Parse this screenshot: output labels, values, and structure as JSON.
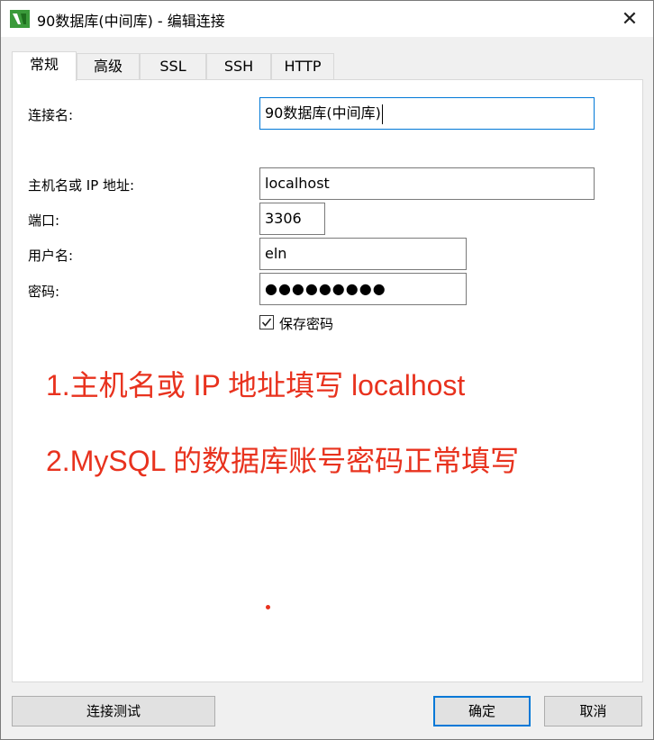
{
  "window": {
    "title": "90数据库(中间库) - 编辑连接",
    "close_symbol": "✕"
  },
  "tabs": [
    {
      "label": "常规",
      "active": true
    },
    {
      "label": "高级",
      "active": false
    },
    {
      "label": "SSL",
      "active": false
    },
    {
      "label": "SSH",
      "active": false
    },
    {
      "label": "HTTP",
      "active": false
    }
  ],
  "form": {
    "connection_name": {
      "label": "连接名:",
      "value": "90数据库(中间库)"
    },
    "host": {
      "label": "主机名或 IP 地址:",
      "value": "localhost"
    },
    "port": {
      "label": "端口:",
      "value": "3306"
    },
    "username": {
      "label": "用户名:",
      "value": "eln"
    },
    "password": {
      "label": "密码:",
      "value": "●●●●●●●●●"
    },
    "save_password": {
      "label": "保存密码",
      "checked": true
    }
  },
  "annotations": {
    "line1": "1.主机名或 IP 地址填写 localhost",
    "line2": "2.MySQL 的数据库账号密码正常填写",
    "color": "#e8321e"
  },
  "buttons": {
    "test": "连接测试",
    "ok": "确定",
    "cancel": "取消"
  }
}
